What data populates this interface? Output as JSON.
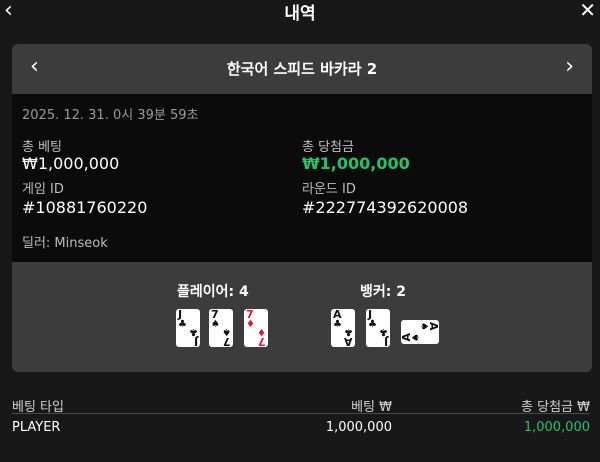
{
  "header": {
    "title": "내역",
    "back_icon": "chevron-left-icon",
    "close_icon": "close-icon"
  },
  "game": {
    "name": "한국어 스피드 바카라 2"
  },
  "info": {
    "datetime": "2025. 12. 31. 0시 39분 59초",
    "total_bet_label": "총 베팅",
    "total_bet_value": "₩1,000,000",
    "total_win_label": "총 당첨금",
    "total_win_value": "₩1,000,000",
    "game_id_label": "게임 ID",
    "game_id_value": "#10881760220",
    "round_id_label": "라운드 ID",
    "round_id_value": "#222774392620008",
    "dealer": "딜러: Minseok"
  },
  "hands": {
    "player_label": "플레이어: 4",
    "banker_label": "뱅커: 2",
    "player_cards": [
      {
        "rank": "J",
        "suit": "♣",
        "color": "#111111",
        "sideways": false
      },
      {
        "rank": "7",
        "suit": "♠",
        "color": "#111111",
        "sideways": false
      },
      {
        "rank": "7",
        "suit": "♦",
        "color": "#e0182a",
        "sideways": false
      }
    ],
    "banker_cards": [
      {
        "rank": "A",
        "suit": "♣",
        "color": "#111111",
        "sideways": false
      },
      {
        "rank": "J",
        "suit": "♣",
        "color": "#111111",
        "sideways": false
      },
      {
        "rank": "A",
        "suit": "♠",
        "color": "#111111",
        "sideways": true
      }
    ]
  },
  "table": {
    "columns": [
      "베팅 타입",
      "베팅 ₩",
      "총 당첨금 ₩"
    ],
    "rows": [
      {
        "type": "PLAYER",
        "bet": "1,000,000",
        "win": "1,000,000"
      }
    ]
  },
  "colors": {
    "win_green": "#21c46a",
    "card_red": "#e0182a"
  }
}
